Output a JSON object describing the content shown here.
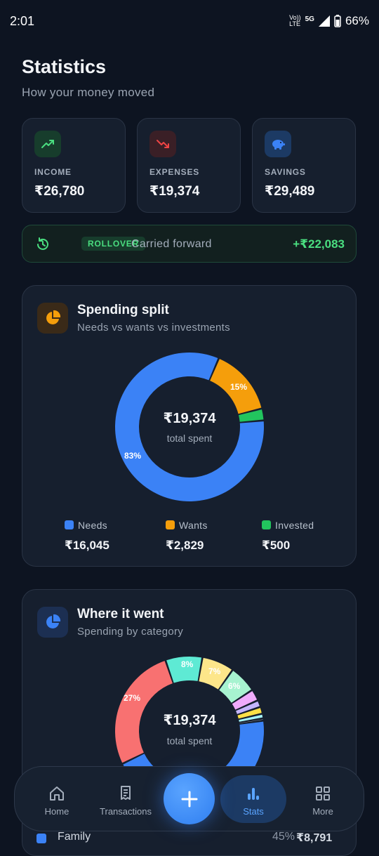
{
  "status": {
    "time": "2:01",
    "net_top": "Vo))",
    "net_bottom": "LTE",
    "signal": "5G",
    "battery": "66%"
  },
  "header": {
    "title": "Statistics",
    "subtitle": "How your money moved"
  },
  "stats": [
    {
      "label": "INCOME",
      "value": "₹26,780",
      "icon": "trending-up-icon",
      "color": "#4ade80"
    },
    {
      "label": "EXPENSES",
      "value": "₹19,374",
      "icon": "trending-down-icon",
      "color": "#ef4444"
    },
    {
      "label": "SAVINGS",
      "value": "₹29,489",
      "icon": "piggy-bank-icon",
      "color": "#3b82f6"
    }
  ],
  "rollover": {
    "badge": "ROLLOVER",
    "text": "Carried forward",
    "value": "+₹22,083"
  },
  "spending_split": {
    "title": "Spending split",
    "subtitle": "Needs vs wants vs investments",
    "center_value": "₹19,374",
    "center_label": "total spent",
    "slice_labels": {
      "needs": "83%",
      "wants": "15%"
    },
    "legend": [
      {
        "name": "Needs",
        "value": "₹16,045",
        "color": "#3b82f6"
      },
      {
        "name": "Wants",
        "value": "₹2,829",
        "color": "#f59e0b"
      },
      {
        "name": "Invested",
        "value": "₹500",
        "color": "#22c55e"
      }
    ]
  },
  "where_it_went": {
    "title": "Where it went",
    "subtitle": "Spending by category",
    "center_value": "₹19,374",
    "center_label": "total spent",
    "slice_labels": {
      "big": "27%",
      "teal": "8%",
      "yellow": "7%",
      "mint": "6%"
    }
  },
  "category_row": {
    "name": "Family",
    "pct": "45%",
    "amount": "₹8,791"
  },
  "nav": {
    "home": "Home",
    "transactions": "Transactions",
    "stats": "Stats",
    "more": "More"
  },
  "chart_data": [
    {
      "type": "pie",
      "title": "Spending split",
      "categories": [
        "Needs",
        "Wants",
        "Invested"
      ],
      "values": [
        16045,
        2829,
        500
      ],
      "percent_labels": [
        "83%",
        "15%",
        ""
      ]
    },
    {
      "type": "pie",
      "title": "Where it went",
      "categories": [
        "Family",
        "",
        "",
        "",
        "",
        "",
        "",
        "",
        "",
        ""
      ],
      "values": [
        45,
        27,
        8,
        7,
        6,
        2.5,
        1.5,
        1.5,
        1,
        0.5
      ],
      "percent_labels": [
        "",
        "27%",
        "8%",
        "7%",
        "6%",
        "",
        "",
        "",
        "",
        ""
      ],
      "colors": [
        "#3b82f6",
        "#f87171",
        "#5eead4",
        "#fde68a",
        "#a7f3d0",
        "#f0abfc",
        "#c4b5fd",
        "#fde047",
        "#a5f3fc",
        "#9ca3af"
      ]
    }
  ]
}
